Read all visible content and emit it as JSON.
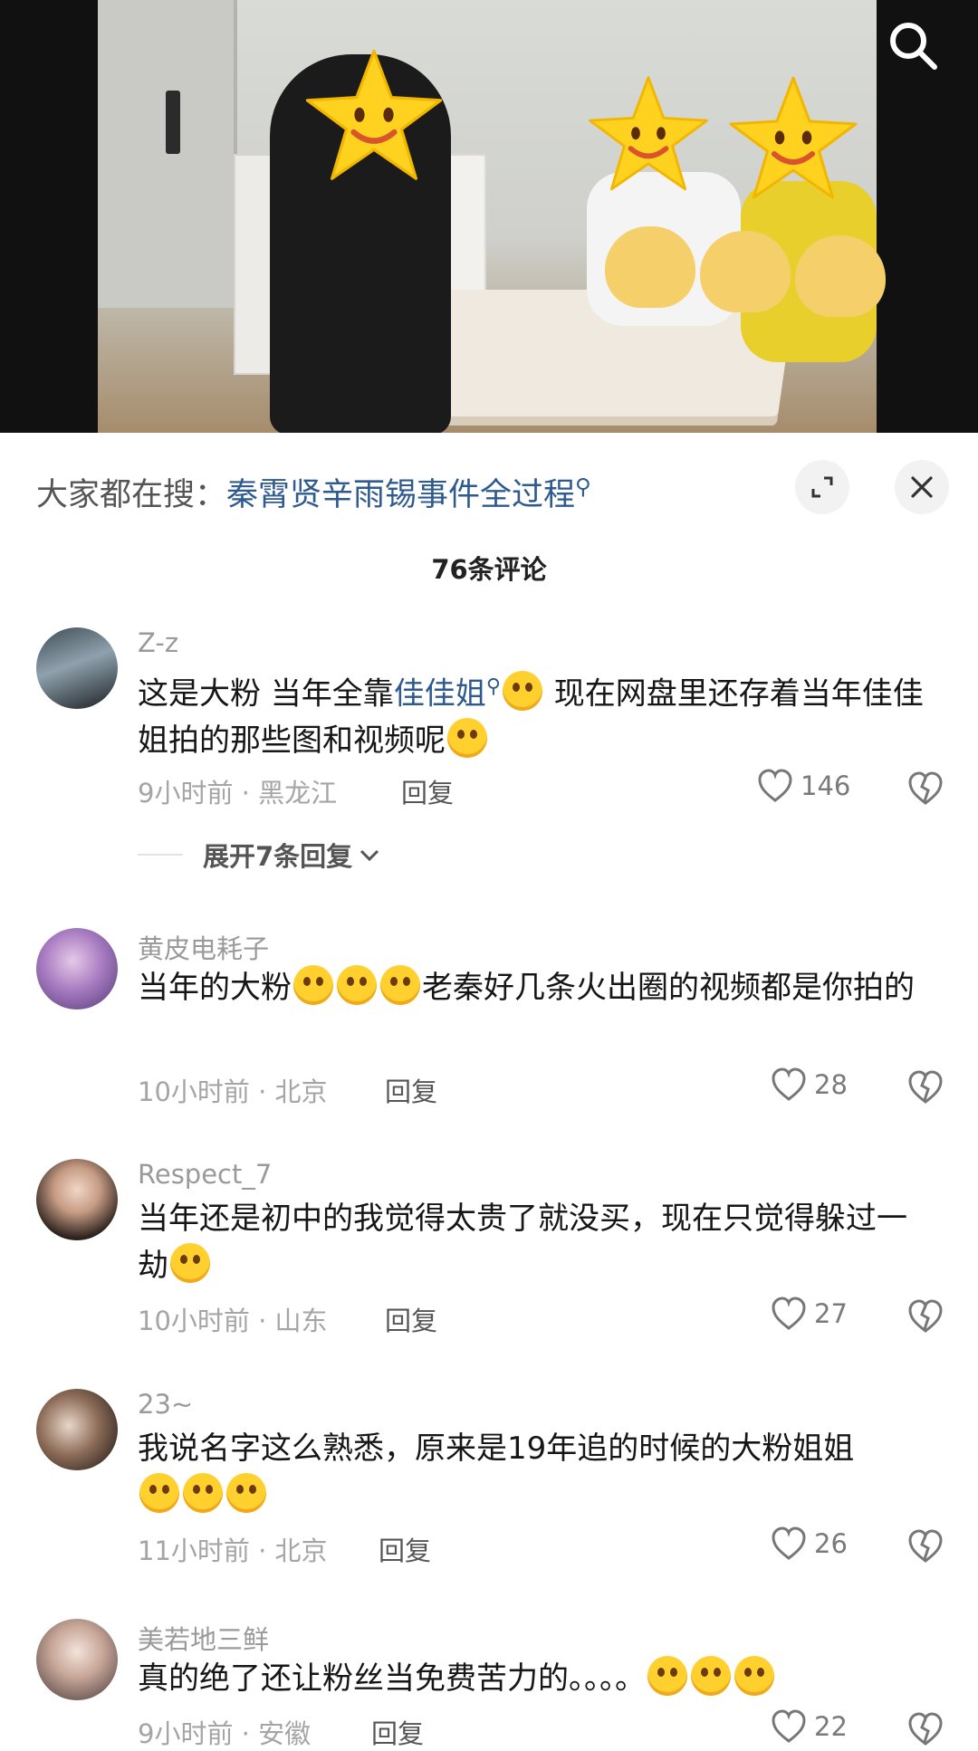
{
  "hot_search": {
    "prefix": "大家都在搜：",
    "query": "秦霄贤辛雨锡事件全过程"
  },
  "comments_header": {
    "count_label": "76条评论"
  },
  "comments": [
    {
      "username": "Z-z",
      "text_before": "这是大粉 当年全靠",
      "link": "佳佳姐",
      "text_after": " 现在网盘里还存着当年佳佳姐拍的那些图和视频呢",
      "time": "9小时前 · 黑龙江",
      "reply_label": "回复",
      "likes": "146",
      "expand_label": "展开7条回复"
    },
    {
      "username": "黄皮电耗子",
      "text_before": "当年的大粉",
      "text_after": "老秦好几条火出圈的视频都是你拍的",
      "time": "10小时前 · 北京",
      "reply_label": "回复",
      "likes": "28"
    },
    {
      "username": "Respect_7",
      "text_before": "当年还是初中的我觉得太贵了就没买，现在只觉得躲过一劫",
      "time": "10小时前 · 山东",
      "reply_label": "回复",
      "likes": "27"
    },
    {
      "username": "23~",
      "text_before": "我说名字这么熟悉，原来是19年追的时候的大粉姐姐",
      "time": "11小时前 · 北京",
      "reply_label": "回复",
      "likes": "26"
    },
    {
      "username": "美若地三鲜",
      "text_before": "真的绝了还让粉丝当免费苦力的。。。。",
      "time": "9小时前 · 安徽",
      "reply_label": "回复",
      "likes": "22"
    }
  ],
  "icons": {
    "search": "search-icon",
    "expand": "expand-icon",
    "close": "close-icon",
    "like": "heart-icon",
    "dislike": "broken-heart-icon",
    "chevron": "chevron-down-icon"
  },
  "colors": {
    "link": "#2e5a8f",
    "muted": "#a5a5a5",
    "sheet_bg": "#ffffff",
    "video_bg": "#111111"
  }
}
